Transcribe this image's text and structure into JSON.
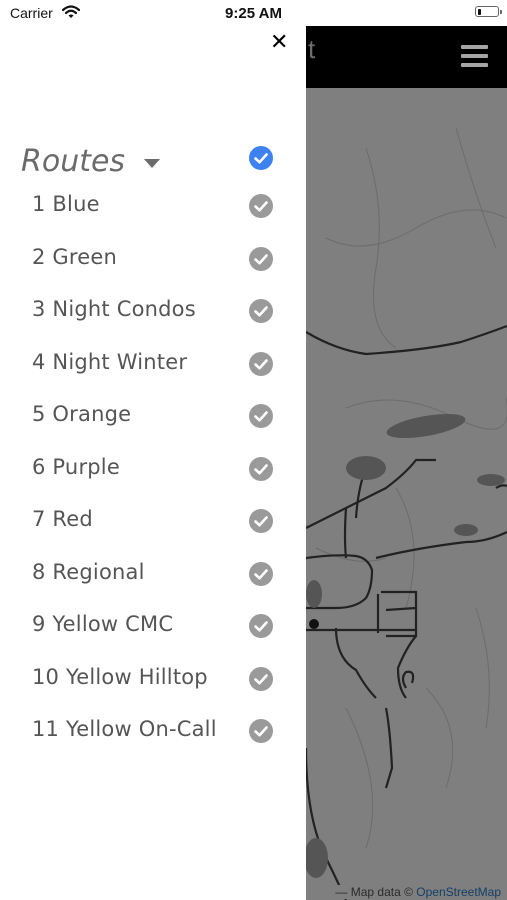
{
  "status_bar": {
    "carrier": "Carrier",
    "time": "9:25 AM",
    "battery_level": 0.2
  },
  "map": {
    "header_title_fragment": "t",
    "attribution_prefix": "— Map data ©",
    "attribution_link": "OpenStreetMap",
    "background_color": "#7f7f7f"
  },
  "drawer": {
    "close_icon": "close-icon",
    "routes_title": "Routes",
    "accent_color": "#3d82f0",
    "check_color": "#9a9a9a",
    "routes": [
      {
        "label": "1 Blue",
        "checked": true
      },
      {
        "label": "2 Green",
        "checked": true
      },
      {
        "label": "3 Night Condos",
        "checked": true
      },
      {
        "label": "4 Night Winter",
        "checked": true
      },
      {
        "label": "5 Orange",
        "checked": true
      },
      {
        "label": "6 Purple",
        "checked": true
      },
      {
        "label": "7 Red",
        "checked": true
      },
      {
        "label": "8 Regional",
        "checked": true
      },
      {
        "label": "9 Yellow CMC",
        "checked": true
      },
      {
        "label": "10 Yellow Hilltop",
        "checked": true
      },
      {
        "label": "11 Yellow On-Call",
        "checked": true
      }
    ]
  }
}
